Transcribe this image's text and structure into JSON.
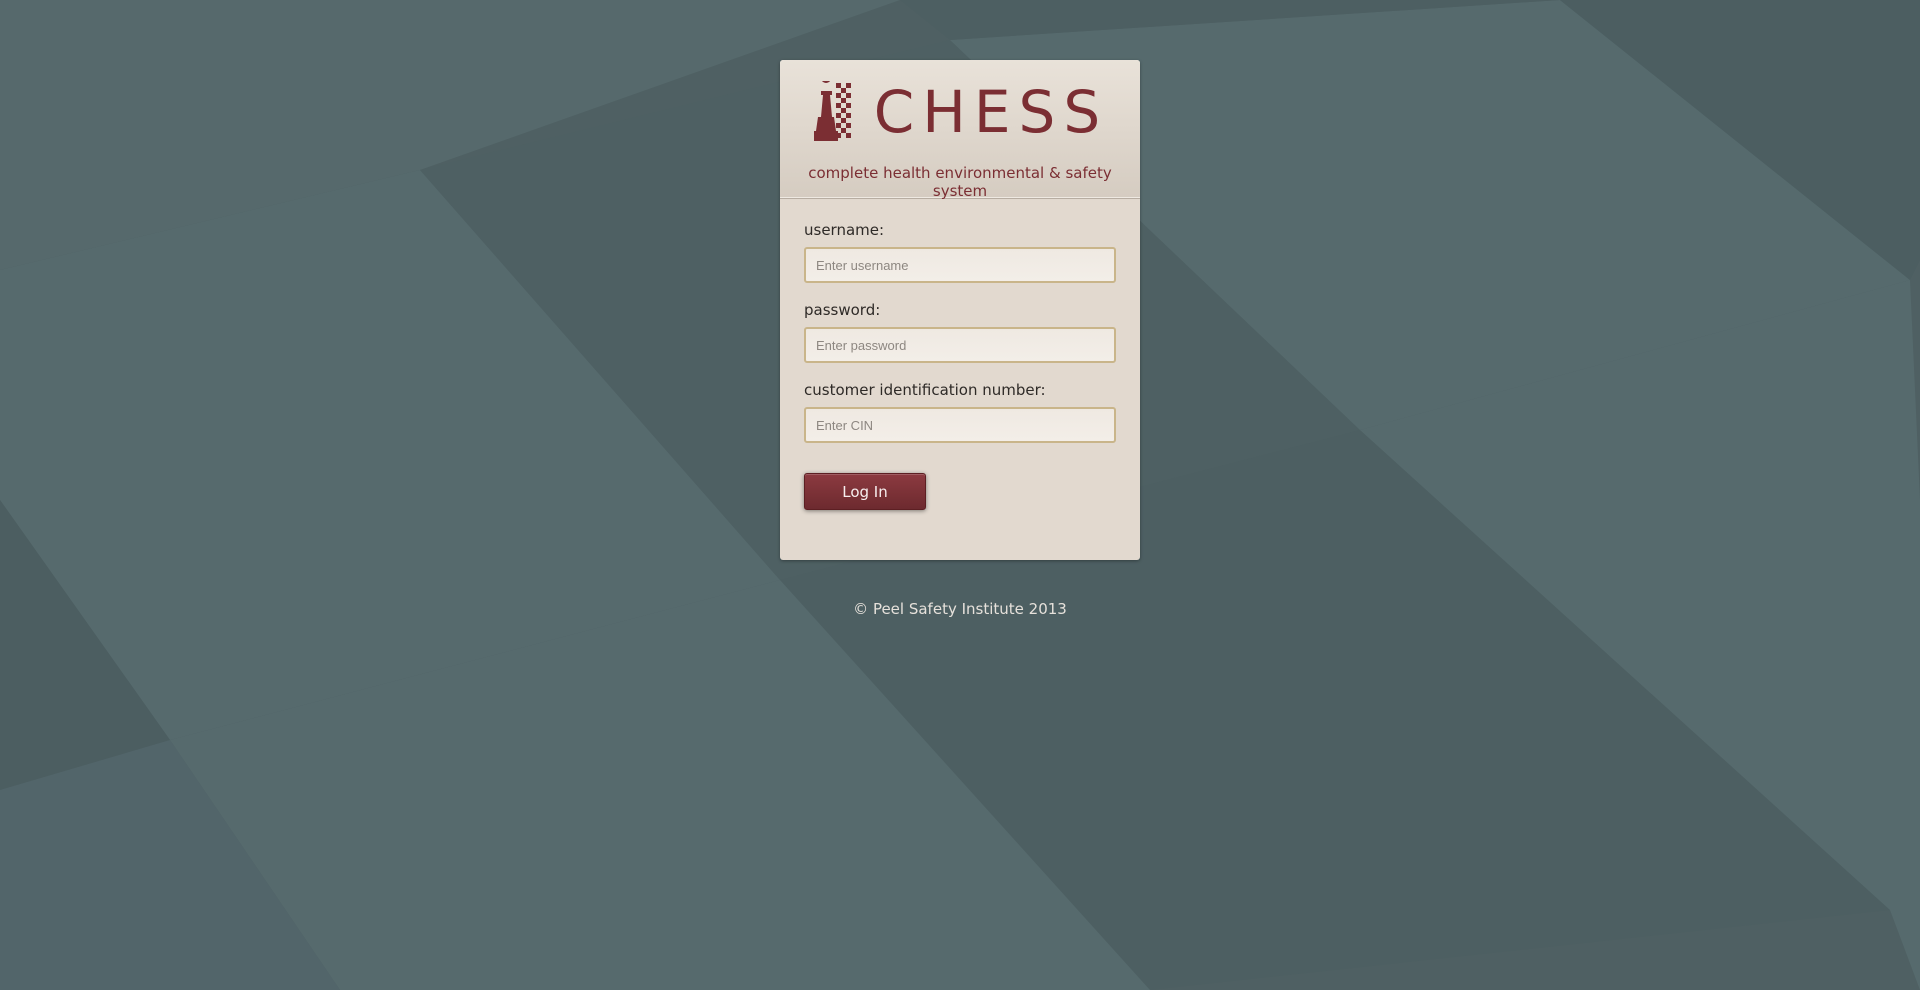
{
  "brand": {
    "logo_text": "CHESS",
    "subtitle": "complete health environmental & safety system",
    "logo_icon": "chess-pawn-checker-icon",
    "accent_color": "#7b2e33"
  },
  "form": {
    "username_label": "username:",
    "username_placeholder": "Enter username",
    "username_value": "",
    "password_label": "password:",
    "password_placeholder": "Enter password",
    "password_value": "",
    "cin_label": "customer identification number:",
    "cin_placeholder": "Enter CIN",
    "cin_value": "",
    "login_label": "Log In"
  },
  "footer": {
    "copyright": "© Peel Safety Institute 2013"
  },
  "colors": {
    "background": "#4f6063",
    "card": "#e2d9cf",
    "button": "#7b2e33"
  }
}
